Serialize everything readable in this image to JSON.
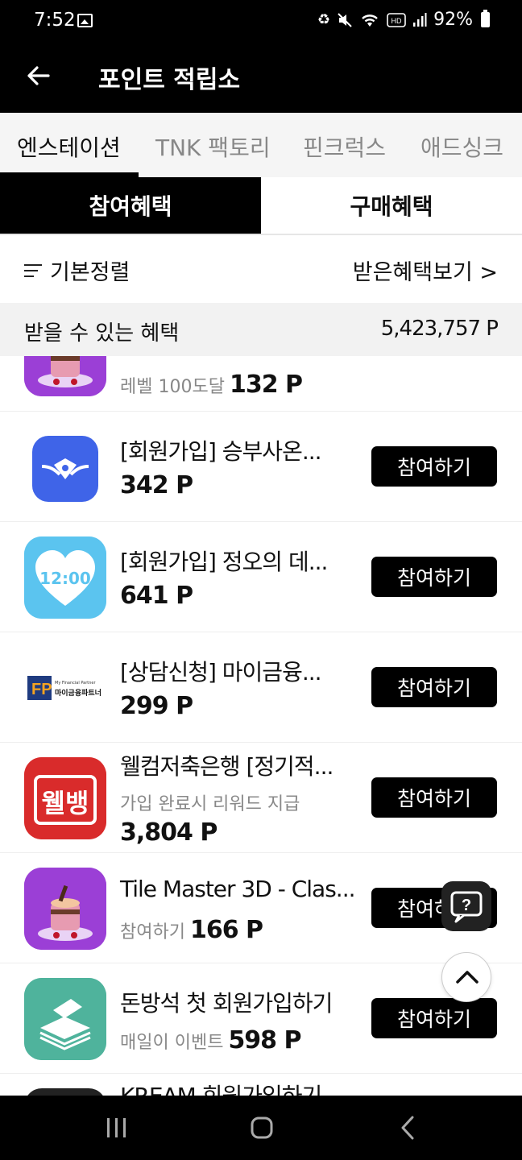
{
  "status": {
    "time": "7:52",
    "battery": "92%",
    "icons": [
      "gallery-icon",
      "battery-saver-icon",
      "mute-icon",
      "wifi-icon",
      "hd-voice-icon",
      "signal-icon",
      "battery-icon"
    ]
  },
  "appbar": {
    "title": "포인트 적립소"
  },
  "tabs": [
    "엔스테이션",
    "TNK 팩토리",
    "핀크럭스",
    "애드싱크"
  ],
  "segments": {
    "participate": "참여혜택",
    "purchase": "구매혜택"
  },
  "sort": {
    "label": "기본정렬",
    "view_received": "받은혜택보기 >"
  },
  "summary": {
    "label": "받을 수 있는 혜택",
    "value": "5,423,757 P"
  },
  "join_label": "참여하기",
  "items": [
    {
      "name": "",
      "sub": "레벨 100도달",
      "points": "132 P"
    },
    {
      "name": "[회원가입] 승부사온...",
      "sub": "",
      "points": "342 P"
    },
    {
      "name": "[회원가입] 정오의 데...",
      "sub": "",
      "points": "641 P",
      "icon_text": "12:00"
    },
    {
      "name": "[상담신청] 마이금융...",
      "sub": "",
      "points": "299 P",
      "icon_text": "마이금융파트너",
      "icon_small": "My Financial Partner"
    },
    {
      "name": "웰컴저축은행 [정기적...",
      "sub": "가입 완료시 리워드 지급",
      "points": "3,804 P",
      "icon_text": "웰뱅"
    },
    {
      "name": "Tile Master 3D - Clas...",
      "sub": "참여하기",
      "points": "166 P"
    },
    {
      "name": "돈방석 첫 회원가입하기",
      "sub": "매일이 이벤트",
      "points": "598 P"
    },
    {
      "name": "KREAM 회원가입하기",
      "sub": "",
      "points": ""
    }
  ],
  "colors": {
    "black": "#000000",
    "tab_bg": "#f5f5f5",
    "welbank_red": "#d92b2b",
    "heart_blue": "#5bc4ef",
    "money_teal": "#4fb39c",
    "tile_purple": "#8a2fc7"
  }
}
